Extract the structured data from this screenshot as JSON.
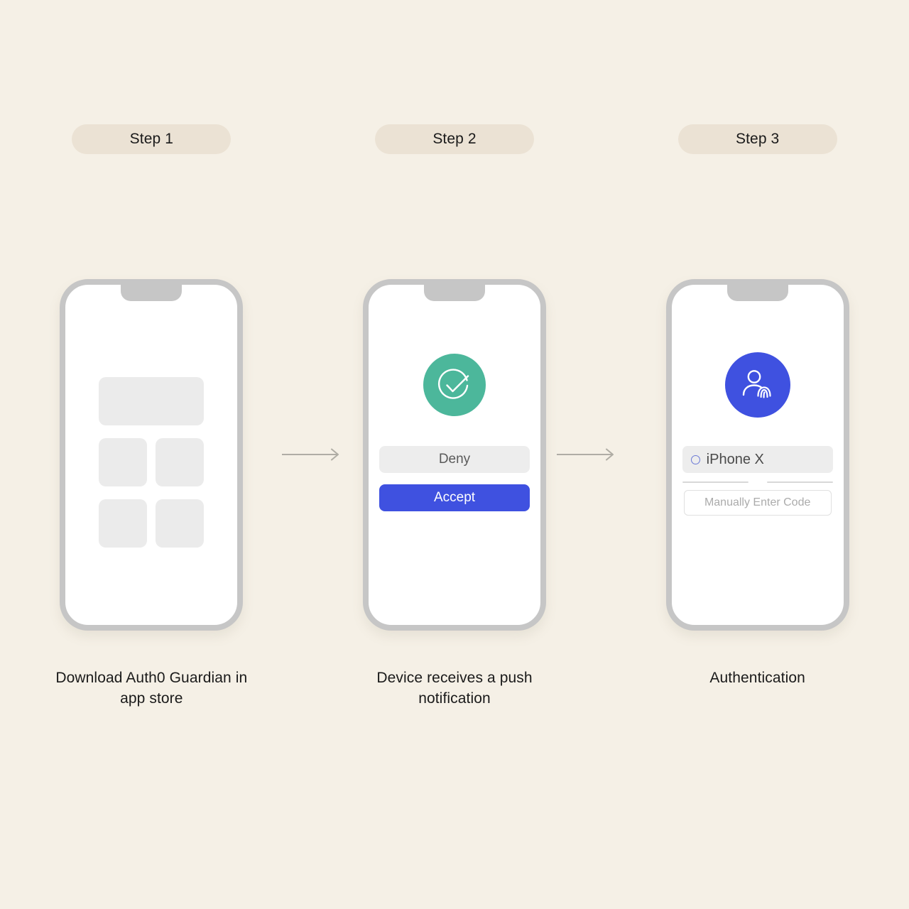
{
  "page": {
    "background_color": "#F5F0E6",
    "title": "Auth0 Guardian MFA enrollment steps"
  },
  "colors": {
    "background": "#F5F0E6",
    "pill": "#EBE2D4",
    "accent_blue": "#3F51E0",
    "accent_green": "#4CB79B",
    "phone_frame": "#C6C6C6",
    "placeholder_gray": "#EBEBEB",
    "deny_gray": "#EDEDED",
    "arrow_gray": "#B0ADA5"
  },
  "steps": [
    {
      "pill_label": "Step 1",
      "caption": "Download Auth0 Guardian in app store",
      "screen": {
        "kind": "app-grid",
        "placeholders": [
          "wide-banner",
          "tile",
          "tile",
          "tile",
          "tile"
        ]
      }
    },
    {
      "pill_label": "Step 2",
      "caption": "Device receives a push notification",
      "screen": {
        "kind": "push-notification",
        "icon": "check-circle-icon",
        "deny_label": "Deny",
        "accept_label": "Accept"
      }
    },
    {
      "pill_label": "Step 3",
      "caption": "Authentication",
      "screen": {
        "kind": "authentication",
        "icon": "person-fingerprint-icon",
        "device_label": "iPhone X",
        "code_placeholder": "Manually Enter Code"
      }
    }
  ],
  "arrows": [
    {
      "name": "arrow-step1-to-step2",
      "direction": "right"
    },
    {
      "name": "arrow-step2-to-step3",
      "direction": "right"
    }
  ]
}
